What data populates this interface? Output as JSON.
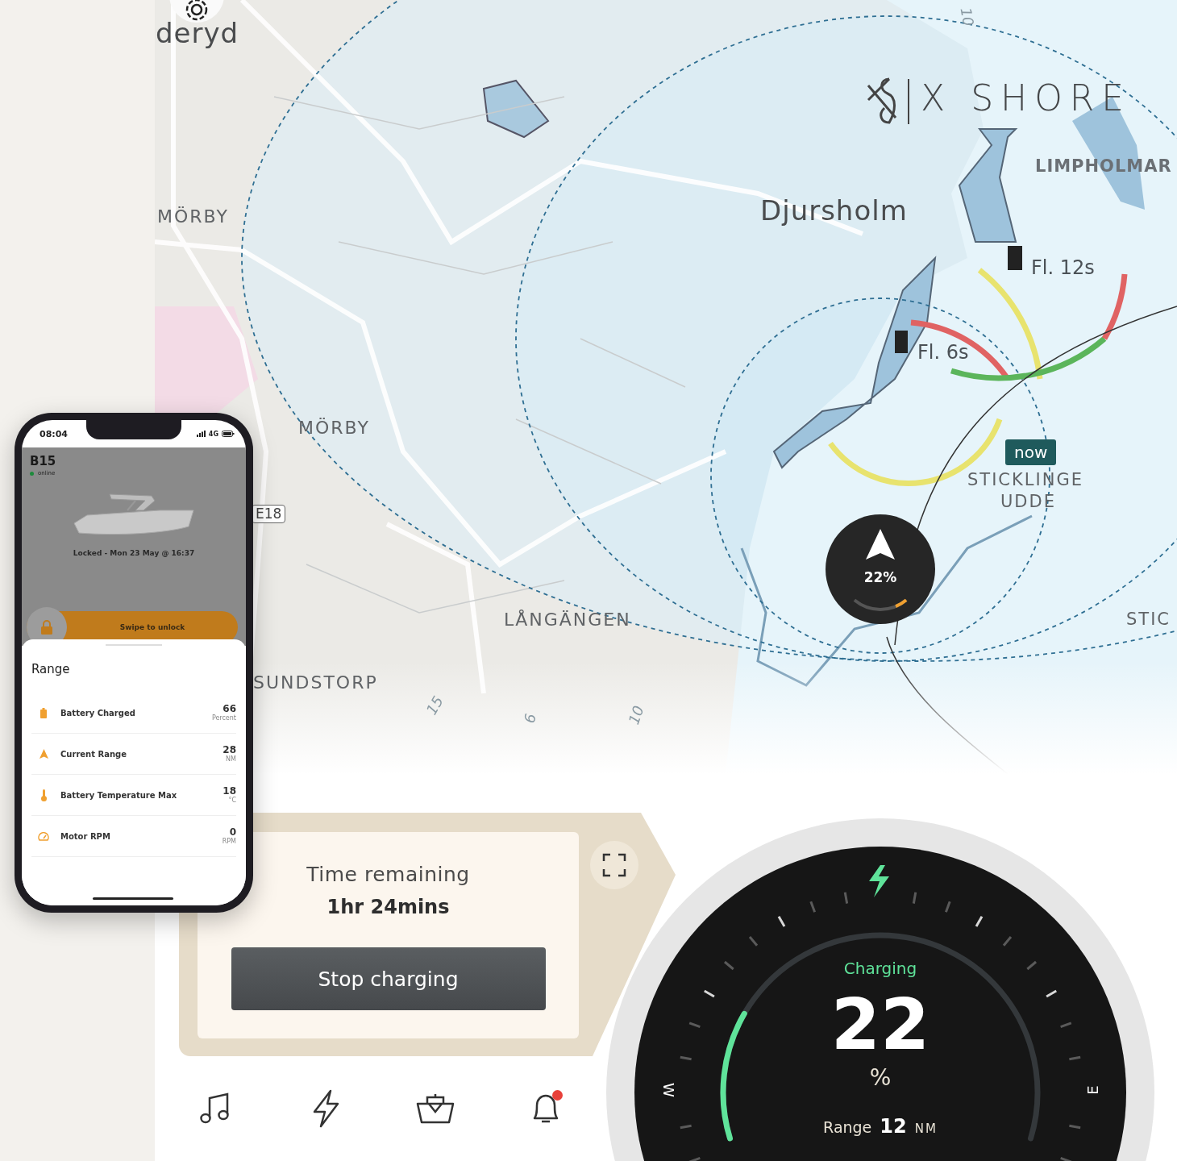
{
  "map": {
    "place_labels": [
      "deryd",
      "MÖRBY",
      "MÖRBY",
      "Djursholm",
      "LIMPHOLMAR",
      "LÅNGÄNGEN",
      "SUNDSTORP",
      "STICKLINGE",
      "UDDE",
      "STIC"
    ],
    "road_sign": "E18",
    "depth_labels": [
      "10",
      "15",
      "6",
      "10"
    ],
    "light_labels": [
      "Fl. 12s",
      "Fl. 6s"
    ],
    "time_marker": "now",
    "logo": "X SHORE",
    "boat_marker": {
      "reading": "22%",
      "level": 0.22
    }
  },
  "charging_panel": {
    "title": "Time remaining",
    "value": "1hr 24mins",
    "button": "Stop charging"
  },
  "gauge": {
    "status": "Charging",
    "value": "22",
    "unit": "%",
    "range_label": "Range",
    "range_value": "12",
    "range_unit": "NM",
    "left_mark": "W",
    "right_mark": "E",
    "level": 0.22
  },
  "nav_icons": [
    {
      "kind": "music",
      "badge": false
    },
    {
      "kind": "bolt",
      "badge": false
    },
    {
      "kind": "boat",
      "badge": false
    },
    {
      "kind": "bell",
      "badge": true
    }
  ],
  "phone": {
    "status_time": "08:04",
    "network": "4G",
    "boat_name": "B15",
    "connection": "online",
    "online": true,
    "lock_status": "Locked - Mon 23 May @ 16:37",
    "unlock_slider": {
      "label": "Swipe to unlock",
      "level": 0
    },
    "sheet_title": "Range",
    "metrics": [
      {
        "kind": "battery",
        "label": "Battery Charged",
        "value": "66",
        "unit": "Percent"
      },
      {
        "kind": "range",
        "label": "Current Range",
        "value": "28",
        "unit": "NM"
      },
      {
        "kind": "temperature",
        "label": "Battery Temperature Max",
        "value": "18",
        "unit": "°C"
      },
      {
        "kind": "rpm",
        "label": "Motor RPM",
        "value": "0",
        "unit": "RPM"
      }
    ]
  }
}
